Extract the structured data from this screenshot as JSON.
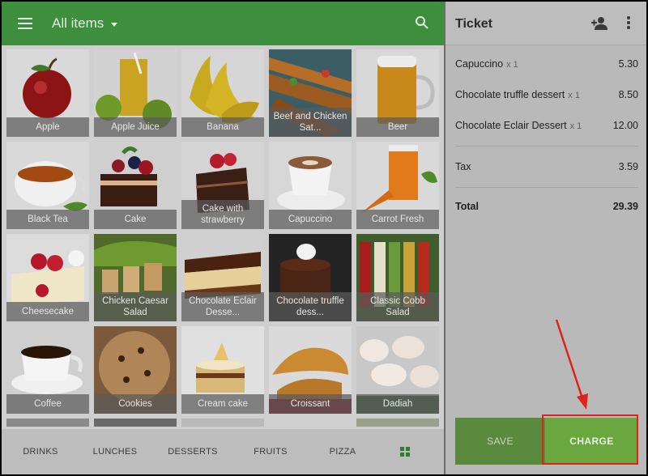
{
  "header": {
    "title": "All items"
  },
  "items": [
    {
      "label": "Apple"
    },
    {
      "label": "Apple Juice"
    },
    {
      "label": "Banana"
    },
    {
      "label": "Beef and Chicken Sat..."
    },
    {
      "label": "Beer"
    },
    {
      "label": "Black Tea"
    },
    {
      "label": "Cake"
    },
    {
      "label": "Cake with strawberry"
    },
    {
      "label": "Capuccino"
    },
    {
      "label": "Carrot Fresh"
    },
    {
      "label": "Cheesecake"
    },
    {
      "label": "Chicken Caesar Salad"
    },
    {
      "label": "Chocolate Eclair Desse..."
    },
    {
      "label": "Chocolate truffle dess..."
    },
    {
      "label": "Classic Cobb Salad"
    },
    {
      "label": "Coffee"
    },
    {
      "label": "Cookies"
    },
    {
      "label": "Cream cake"
    },
    {
      "label": "Croissant"
    },
    {
      "label": "Dadiah"
    }
  ],
  "bottom_nav": [
    "DRINKS",
    "LUNCHES",
    "DESSERTS",
    "FRUITS",
    "PIZZA"
  ],
  "ticket": {
    "title": "Ticket",
    "lines": [
      {
        "name": "Capuccino",
        "qty": "x 1",
        "price": "5.30"
      },
      {
        "name": "Chocolate truffle dessert",
        "qty": "x 1",
        "price": "8.50"
      },
      {
        "name": "Chocolate Eclair Dessert",
        "qty": "x 1",
        "price": "12.00"
      }
    ],
    "tax_label": "Tax",
    "tax_value": "3.59",
    "total_label": "Total",
    "total_value": "29.39"
  },
  "buttons": {
    "save": "SAVE",
    "charge": "CHARGE"
  },
  "colors": {
    "topbar": "#3d8f3d",
    "charge": "#6aa83f",
    "highlight": "#e0221b"
  }
}
